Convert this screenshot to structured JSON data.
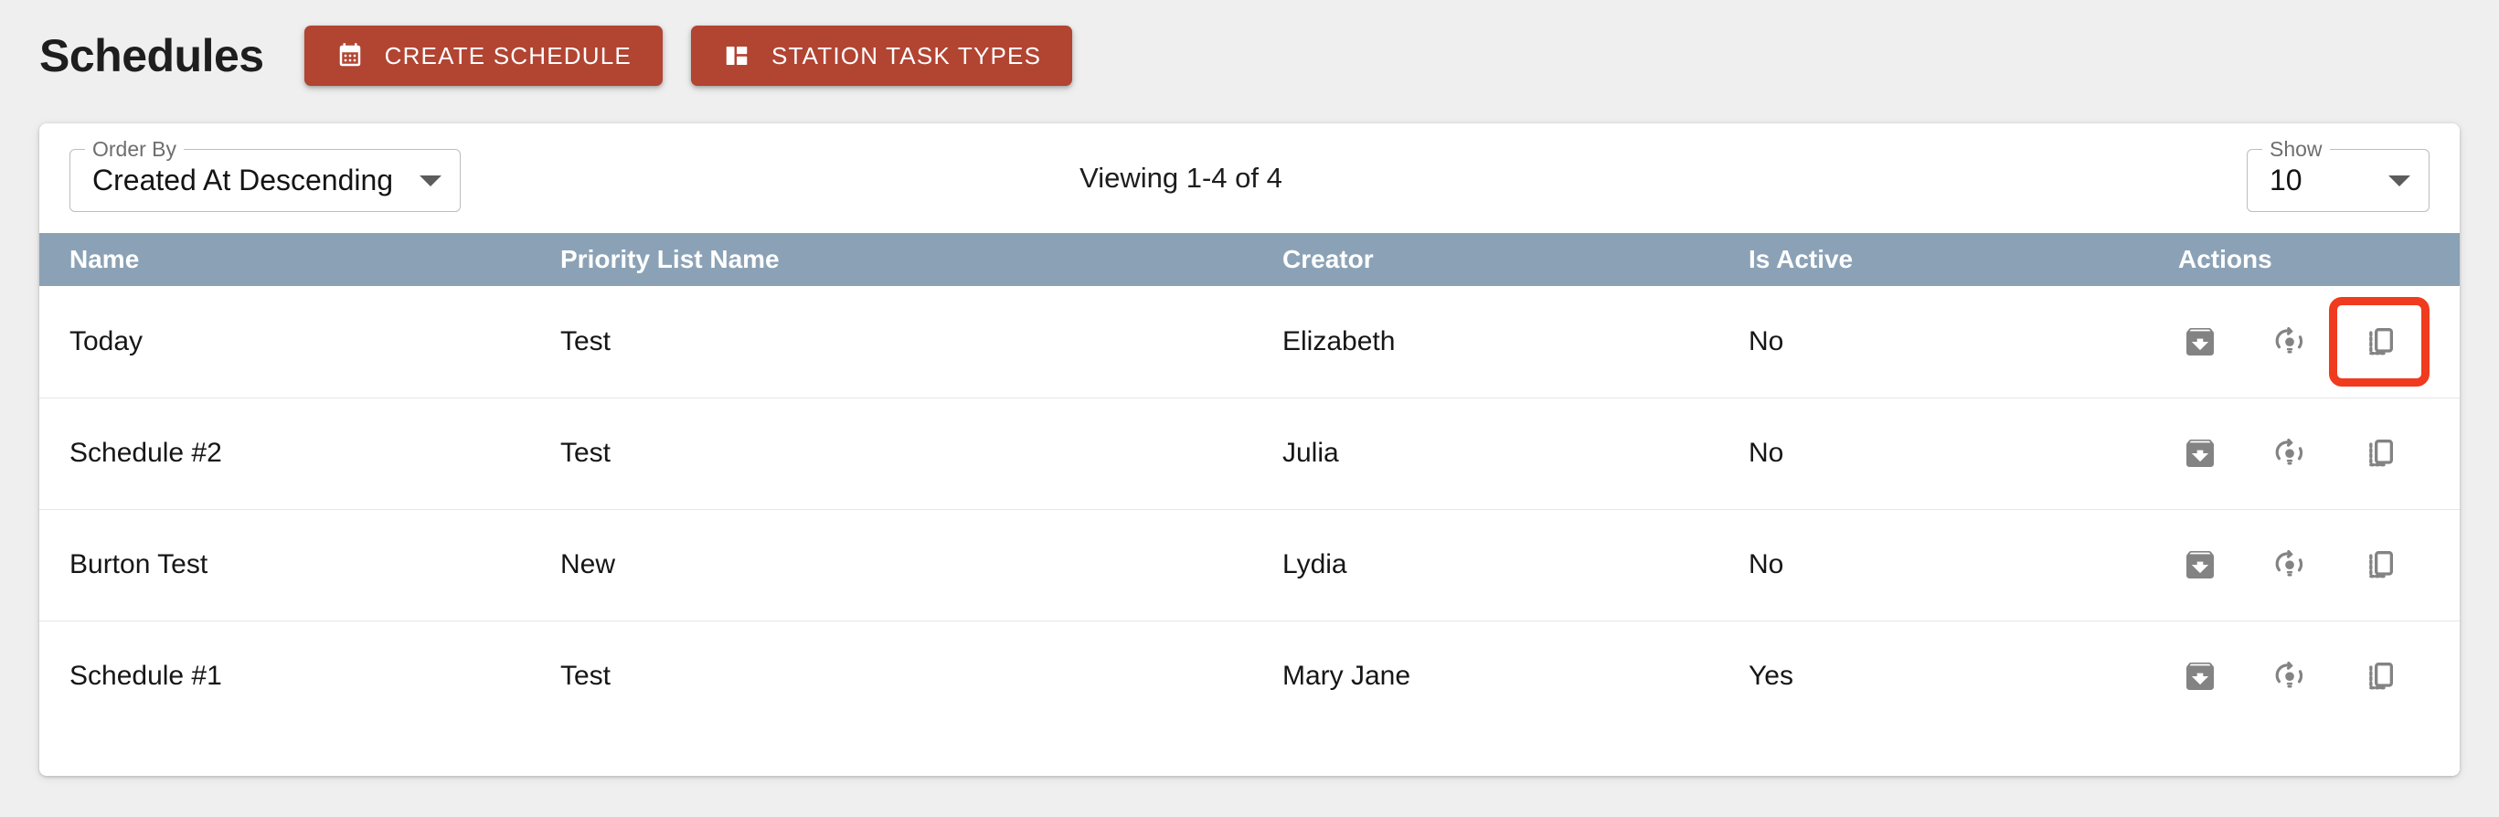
{
  "header": {
    "title": "Schedules",
    "buttons": [
      {
        "label": "CREATE SCHEDULE",
        "icon": "calendar-icon",
        "color": "#b24432"
      },
      {
        "label": "STATION TASK TYPES",
        "icon": "dashboard-layout-icon",
        "color": "#b24432"
      }
    ]
  },
  "toolbar": {
    "order_by": {
      "legend": "Order By",
      "value": "Created At Descending",
      "icon": "chevron-down-icon"
    },
    "viewing": "Viewing 1-4 of 4",
    "show": {
      "legend": "Show",
      "value": "10",
      "icon": "chevron-down-icon"
    }
  },
  "table": {
    "header_bg": "#8ba2b6",
    "columns": [
      "Name",
      "Priority List Name",
      "Creator",
      "Is Active",
      "Actions"
    ],
    "action_icons": [
      "archive-download-icon",
      "lightbulb-refresh-icon",
      "duplicate-copy-icon"
    ],
    "rows": [
      {
        "name": "Today",
        "priority_list_name": "Test",
        "creator": "Elizabeth",
        "is_active": "No",
        "highlight_action": "duplicate-copy-icon"
      },
      {
        "name": "Schedule #2",
        "priority_list_name": "Test",
        "creator": "Julia",
        "is_active": "No",
        "highlight_action": null
      },
      {
        "name": "Burton Test",
        "priority_list_name": "New",
        "creator": "Lydia",
        "is_active": "No",
        "highlight_action": null
      },
      {
        "name": "Schedule #1",
        "priority_list_name": "Test",
        "creator": "Mary Jane",
        "is_active": "Yes",
        "highlight_action": null
      }
    ]
  },
  "annotation": {
    "color": "#f03b1e",
    "target": "duplicate-copy-icon-row-1"
  }
}
